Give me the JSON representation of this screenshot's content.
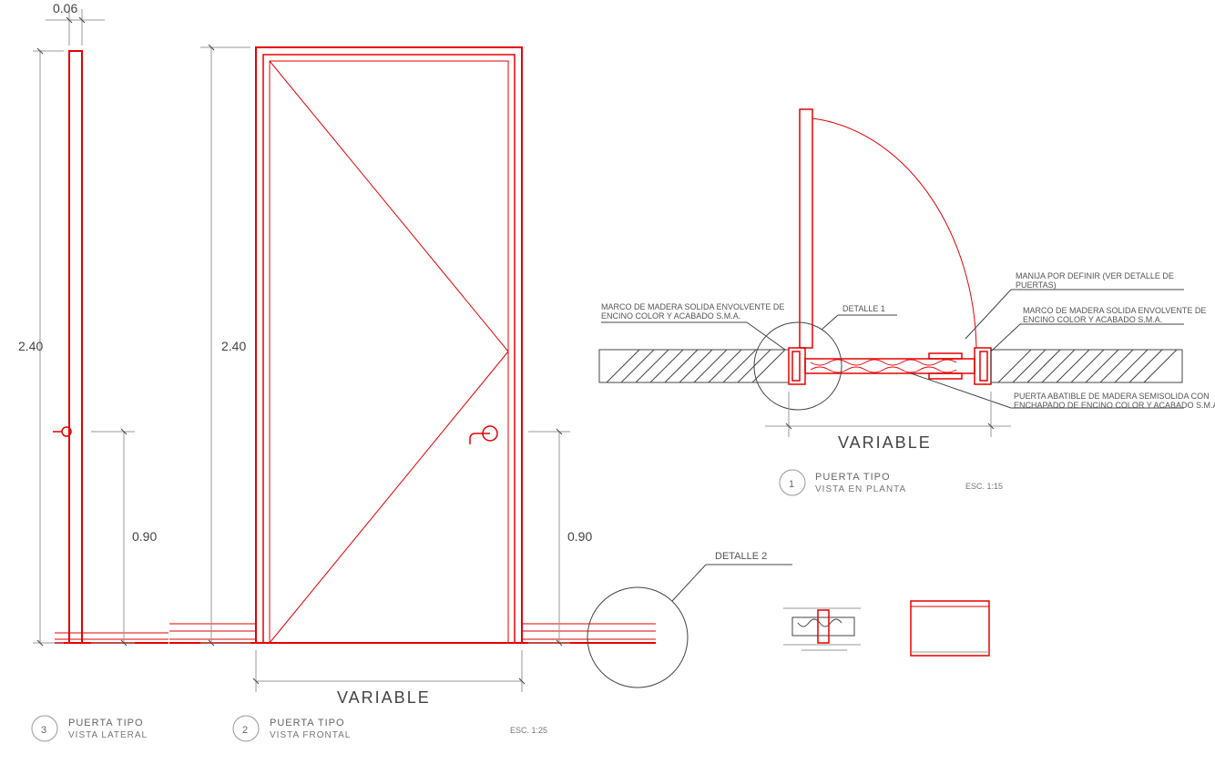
{
  "dims": {
    "thickness": "0.06",
    "height": "2.40",
    "handle_h": "0.90",
    "width_label": "VARIABLE"
  },
  "details": {
    "detalle1": "DETALLE 1",
    "detalle2": "DETALLE 2"
  },
  "annotations": {
    "marco_left": "MARCO DE MADERA SOLIDA ENVOLVENTE DE ENCINO COLOR Y ACABADO S.M.A.",
    "manija": "MANIJA POR DEFINIR (VER DETALLE DE PUERTAS)",
    "marco_right": "MARCO DE MADERA SOLIDA ENVOLVENTE DE ENCINO COLOR Y ACABADO S.M.A.",
    "puerta_abatible": "PUERTA ABATIBLE DE MADERA SEMISOLIDA CON ENCHAPADO DE ENCINO COLOR Y ACABADO S.M.A."
  },
  "titles": {
    "t1_num": "1",
    "t1_line1": "PUERTA TIPO",
    "t1_line2": "VISTA EN PLANTA",
    "t1_scale": "ESC. 1:15",
    "t2_num": "2",
    "t2_line1": "PUERTA TIPO",
    "t2_line2": "VISTA FRONTAL",
    "t2_scale": "ESC. 1:25",
    "t3_num": "3",
    "t3_line1": "PUERTA TIPO",
    "t3_line2": "VISTA LATERAL"
  }
}
